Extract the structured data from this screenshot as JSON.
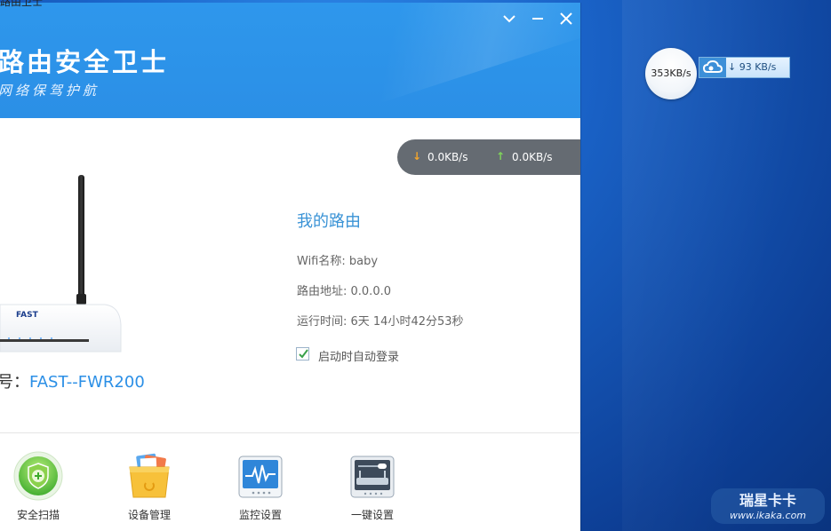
{
  "clipped_title": "路由卫士",
  "app": {
    "title": "路由安全卫士",
    "subtitle": "网络保驾护航",
    "controls": {
      "minimize_tray_icon": "chevron-down-icon",
      "minimize_icon": "minus-icon",
      "close_icon": "close-icon"
    },
    "speed": {
      "download": "0.0KB/s",
      "upload": "0.0KB/s"
    },
    "router": {
      "model_label": "号：",
      "model_value": "FAST--FWR200",
      "brand_text": "FAST"
    },
    "info": {
      "title": "我的路由",
      "wifi_name": "Wifi名称: baby",
      "address": "路由地址: 0.0.0.0",
      "uptime": "运行时间: 6天 14小时42分53秒",
      "auto_login": "启动时自动登录",
      "auto_login_checked": true
    },
    "tools": [
      {
        "label": "安全扫描",
        "icon": "shield-scan-icon"
      },
      {
        "label": "设备管理",
        "icon": "device-box-icon"
      },
      {
        "label": "监控设置",
        "icon": "monitor-wave-icon"
      },
      {
        "label": "一键设置",
        "icon": "router-settings-icon"
      }
    ]
  },
  "desktop": {
    "speed_ball": "353KB/s",
    "speed_bar": "93 KB/s",
    "watermark_title": "瑞星卡卡",
    "watermark_url": "www.ikaka.com"
  },
  "colors": {
    "header_blue": "#2b8fe6",
    "accent_text": "#3a93d6",
    "download_arrow": "#f4a52a",
    "upload_arrow": "#7fd45a"
  }
}
